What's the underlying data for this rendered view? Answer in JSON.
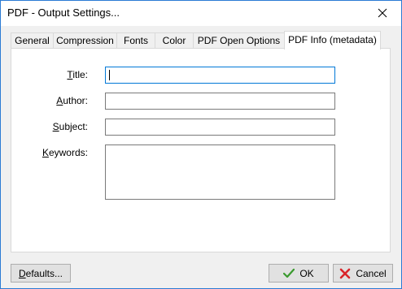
{
  "window": {
    "title": "PDF - Output Settings..."
  },
  "tabs": [
    {
      "label": "General",
      "active": false
    },
    {
      "label": "Compression",
      "active": false
    },
    {
      "label": "Fonts",
      "active": false
    },
    {
      "label": "Color",
      "active": false
    },
    {
      "label": "PDF Open Options",
      "active": false
    },
    {
      "label": "PDF Info (metadata)",
      "active": true
    }
  ],
  "form": {
    "title": {
      "label_underlined": "T",
      "label_rest": "itle:",
      "value": ""
    },
    "author": {
      "label_underlined": "A",
      "label_rest": "uthor:",
      "value": ""
    },
    "subject": {
      "label_underlined": "S",
      "label_rest": "ubject:",
      "value": ""
    },
    "keywords": {
      "label_underlined": "K",
      "label_rest": "eywords:",
      "value": ""
    }
  },
  "footer": {
    "defaults_underlined": "D",
    "defaults_rest": "efaults...",
    "ok_label": "OK",
    "cancel_label": "Cancel"
  },
  "colors": {
    "accent_border": "#2b7bd4",
    "focus_border": "#0078d7",
    "ok_check": "#3a9a2e",
    "cancel_x": "#d9252a"
  },
  "icons": {
    "close": "close-icon",
    "ok": "check-icon",
    "cancel": "x-icon"
  }
}
